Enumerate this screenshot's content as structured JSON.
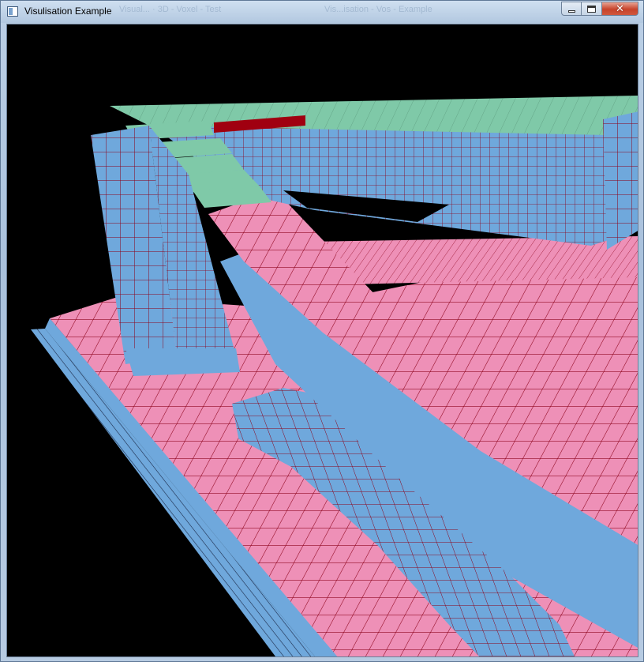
{
  "window": {
    "title": "Visulisation Example",
    "background_titles": [
      "Visual... · 3D - Voxel - Test",
      "Vis...isation - Vos - Example"
    ]
  },
  "scene": {
    "description_free": true,
    "colors": {
      "background": "#000000",
      "floor_top": "#ee90b7",
      "voxel_side": "#6fa8dc",
      "stair_top_green": "#7fc9a8",
      "highlight": "#a00010",
      "grid_line": "#8b0018"
    }
  }
}
